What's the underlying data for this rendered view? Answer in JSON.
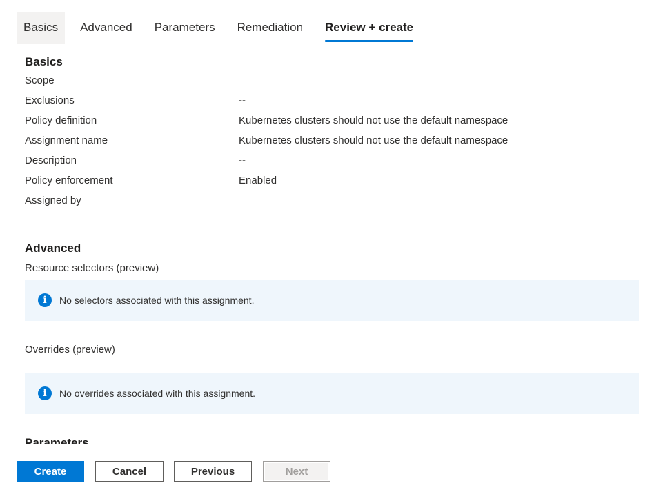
{
  "tabs": [
    {
      "label": "Basics",
      "state": "hovered"
    },
    {
      "label": "Advanced",
      "state": "normal"
    },
    {
      "label": "Parameters",
      "state": "normal"
    },
    {
      "label": "Remediation",
      "state": "normal"
    },
    {
      "label": "Review + create",
      "state": "active"
    }
  ],
  "basics": {
    "title": "Basics",
    "rows": [
      {
        "label": "Scope",
        "value": ""
      },
      {
        "label": "Exclusions",
        "value": "--"
      },
      {
        "label": "Policy definition",
        "value": "Kubernetes clusters should not use the default namespace"
      },
      {
        "label": "Assignment name",
        "value": "Kubernetes clusters should not use the default namespace"
      },
      {
        "label": "Description",
        "value": "--"
      },
      {
        "label": "Policy enforcement",
        "value": "Enabled"
      },
      {
        "label": "Assigned by",
        "value": ""
      }
    ]
  },
  "advanced": {
    "title": "Advanced",
    "resource_selectors_label": "Resource selectors (preview)",
    "resource_selectors_info": "No selectors associated with this assignment.",
    "overrides_label": "Overrides (preview)",
    "overrides_info": "No overrides associated with this assignment."
  },
  "parameters": {
    "title": "Parameters"
  },
  "footer": {
    "create_label": "Create",
    "cancel_label": "Cancel",
    "previous_label": "Previous",
    "next_label": "Next"
  },
  "colors": {
    "accent": "#0078d4",
    "info_background": "#eff6fc"
  }
}
